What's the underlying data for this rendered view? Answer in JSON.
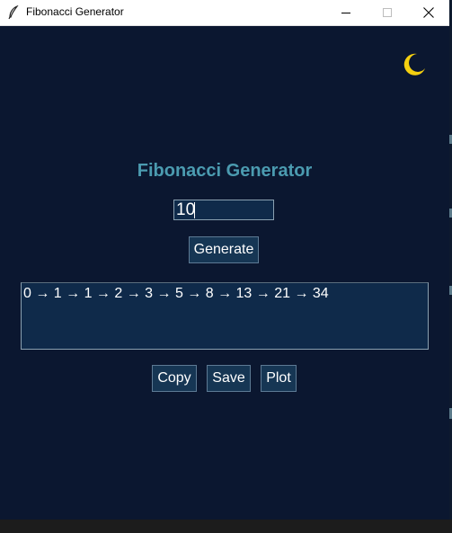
{
  "window": {
    "title": "Fibonacci Generator",
    "controls": [
      "minimize",
      "maximize",
      "close"
    ]
  },
  "theme_toggle": {
    "icon": "moon-icon",
    "color": "#f5d010"
  },
  "heading": "Fibonacci Generator",
  "input": {
    "value": "10"
  },
  "generate_button": "Generate",
  "output": {
    "text": "0 → 1 → 1 → 2 → 3 → 5 → 8 → 13 → 21 → 34"
  },
  "actions": {
    "copy": "Copy",
    "save": "Save",
    "plot": "Plot"
  },
  "colors": {
    "background": "#0b1730",
    "heading": "#4b9bb0",
    "field": "#0f2a4a",
    "button": "#163654"
  }
}
